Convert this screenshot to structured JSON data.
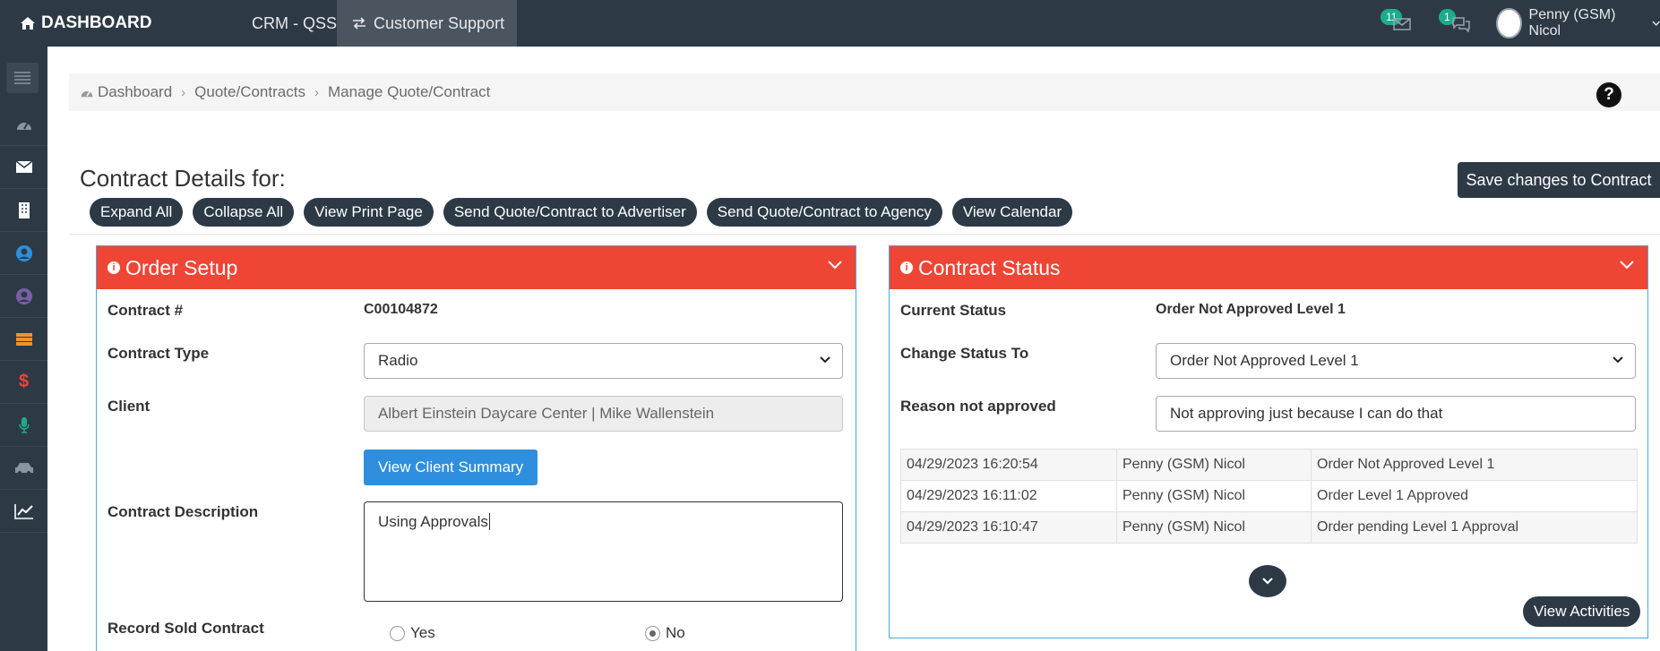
{
  "topbar": {
    "brand": "DASHBOARD",
    "crm_link": "CRM - QSSS",
    "support_link": "Customer Support",
    "mail_count": "11",
    "chat_count": "1",
    "user_name": "Penny (GSM) Nicol"
  },
  "sidebar": {
    "items": [
      "menu-icon",
      "dashboard-icon",
      "mail-icon",
      "building-icon",
      "user-icon",
      "user-circle-icon",
      "stack-icon",
      "dollar-icon",
      "microphone-icon",
      "car-icon",
      "chart-icon"
    ]
  },
  "breadcrumb": {
    "items": [
      "Dashboard",
      "Quote/Contracts",
      "Manage Quote/Contract"
    ]
  },
  "page": {
    "heading": "Contract Details for:",
    "save_label": "Save changes to Contract",
    "actions": [
      "Expand All",
      "Collapse All",
      "View Print Page",
      "Send Quote/Contract to Advertiser",
      "Send Quote/Contract to Agency",
      "View Calendar"
    ]
  },
  "order_setup": {
    "title": "Order Setup",
    "contract_no_label": "Contract #",
    "contract_no": "C00104872",
    "contract_type_label": "Contract Type",
    "contract_type": "Radio",
    "client_label": "Client",
    "client": "Albert Einstein Daycare Center | Mike Wallenstein",
    "view_client_summary": "View Client Summary",
    "description_label": "Contract Description",
    "description": "Using Approvals",
    "record_sold_label": "Record Sold Contract",
    "yes_label": "Yes",
    "no_label": "No"
  },
  "contract_status": {
    "title": "Contract Status",
    "current_status_label": "Current Status",
    "current_status": "Order Not Approved Level 1",
    "change_status_label": "Change Status To",
    "change_status": "Order Not Approved Level 1",
    "reason_label": "Reason not approved",
    "reason": "Not approving just because I can do that",
    "history": [
      {
        "date": "04/29/2023 16:20:54",
        "user": "Penny (GSM) Nicol",
        "status": "Order Not Approved Level 1"
      },
      {
        "date": "04/29/2023 16:11:02",
        "user": "Penny (GSM) Nicol",
        "status": "Order Level 1 Approved"
      },
      {
        "date": "04/29/2023 16:10:47",
        "user": "Penny (GSM) Nicol",
        "status": "Order pending Level 1 Approval"
      }
    ],
    "view_activities": "View Activities"
  },
  "colors": {
    "navbar": "#2d3a46",
    "panel_header": "#ef4535",
    "primary_button": "#2f8fde",
    "badge": "#1bab8e"
  }
}
